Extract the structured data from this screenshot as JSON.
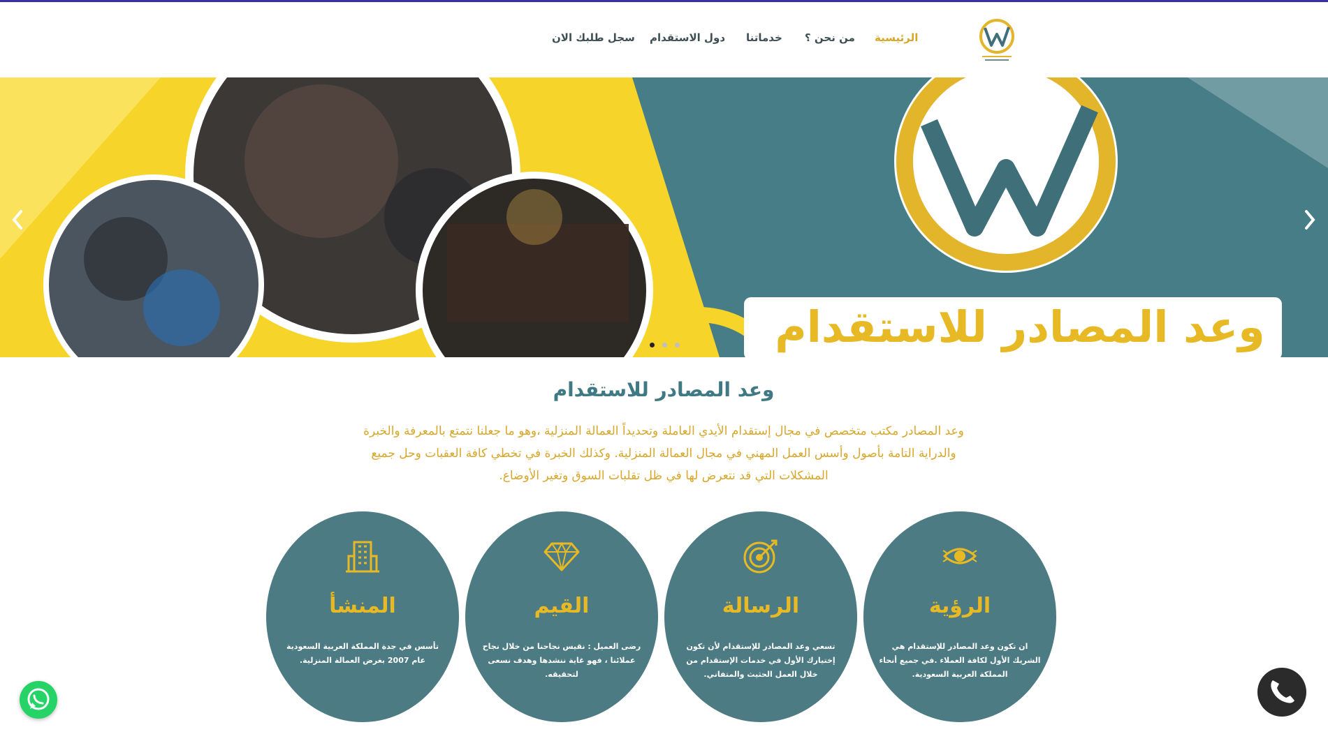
{
  "header": {
    "logo_alt": "WAADALMASADER",
    "nav": [
      {
        "label": "الرئيسية",
        "active": true
      },
      {
        "label": "من نحن ؟",
        "active": false
      },
      {
        "label": "خدماتنا",
        "active": false
      },
      {
        "label": "دول الاستقدام",
        "active": false
      },
      {
        "label": "سجل طلبك الان",
        "active": false
      }
    ]
  },
  "slider": {
    "banner_text": "وعد المصادر للاستقدام",
    "slide_count": 3,
    "active_slide": 1
  },
  "intro": {
    "title": "وعد المصادر للاستقدام",
    "text": "وعد المصادر مكتب متخصص في مجال إستقدام الأيدي العاملة وتحديداً العمالة المنزلية ،وهو ما جعلنا نتمتع بالمعرفة والخبرة والدراية التامة بأصول وأسس العمل المهني في مجال العمالة المنزلية. وكذلك الخبرة في تخطي كافة العقبات وحل جميع المشكلات التي قد نتعرض لها في ظل تقلبات السوق وتغير الأوضاع."
  },
  "cards": [
    {
      "icon": "eye-icon",
      "title": "الرؤية",
      "desc": "ان تكون وعد المصادر للإستقدام هي الشريك الأول لكافة العملاء .في جميع أنحاء المملكة العربية السعودية."
    },
    {
      "icon": "target-icon",
      "title": "الرسالة",
      "desc": "تسعي وعد المصادر للإستقدام لأن تكون إختيارك الأول في خدمات الإستقدام من خلال العمل الحثيث والمتفاني."
    },
    {
      "icon": "diamond-icon",
      "title": "القيم",
      "desc": "رضى العميل : نقيس نجاحنا من خلال نجاح عملائنا ، فهو غاية ننشدها وهدف نسعى لتحقيقه."
    },
    {
      "icon": "building-icon",
      "title": "المنشأ",
      "desc": "تأسس في جدة المملكة العربية السعودية عام 2007 بغرض العمالة المنزلية."
    }
  ],
  "colors": {
    "gold": "#e7b924",
    "teal": "#4c7b83",
    "nav_active": "#d8a72a"
  }
}
